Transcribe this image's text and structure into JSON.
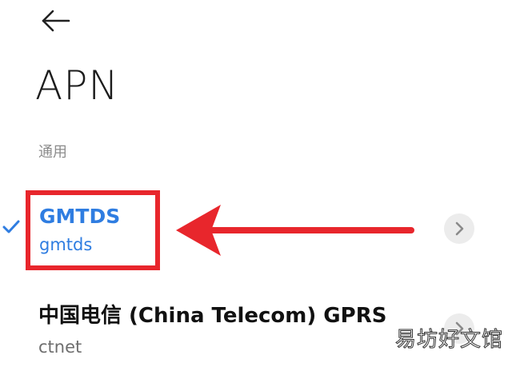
{
  "toolbar": {
    "back_icon": "arrow-left-icon"
  },
  "page": {
    "title": "APN",
    "section_label": "通用"
  },
  "apn_list": [
    {
      "name": "GMTDS",
      "apn": "gmtds",
      "selected": true,
      "status_icon": "check-icon",
      "detail_icon": "chevron-right-icon"
    },
    {
      "name": "中国电信 (China Telecom) GPRS",
      "apn": "ctnet",
      "selected": false,
      "detail_icon": "chevron-right-icon"
    }
  ],
  "annotation": {
    "highlight_color": "#e8262c",
    "arrow_color": "#e8262c"
  },
  "colors": {
    "accent": "#2f7de1",
    "title": "#1c1c1c",
    "section": "#8c8c8c",
    "chevron_bg": "#ececec"
  },
  "watermark": {
    "text": "易坊好文馆"
  }
}
